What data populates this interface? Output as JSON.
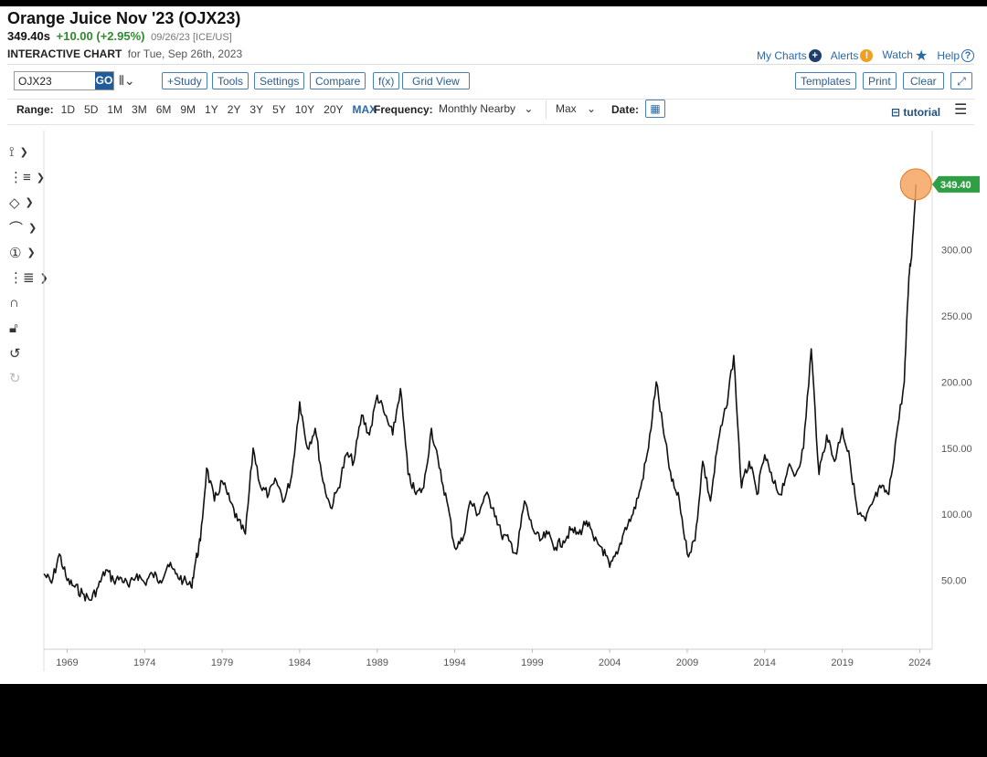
{
  "header": {
    "title": "Orange Juice Nov '23 (OJX23)",
    "price": "349.40s",
    "change": "+10.00 (+2.95%)",
    "meta": "09/26/23 [ICE/US]",
    "subhead_bold": "INTERACTIVE CHART",
    "subhead_text": "for Tue, Sep 26th, 2023"
  },
  "toplinks": {
    "my_charts": "My Charts",
    "alerts": "Alerts",
    "watch": "Watch",
    "help": "Help"
  },
  "toolbar": {
    "symbol_value": "OJX23",
    "go_label": "GO",
    "study_label": "+Study",
    "tools_label": "Tools",
    "settings_label": "Settings",
    "compare_label": "Compare",
    "fx_label": "f(x)",
    "grid_view_label": "Grid View",
    "templates_label": "Templates",
    "print_label": "Print",
    "clear_label": "Clear",
    "expand_icon": "expand-icon"
  },
  "rangebar": {
    "range_label": "Range:",
    "ranges": [
      "1D",
      "5D",
      "1M",
      "3M",
      "6M",
      "9M",
      "1Y",
      "2Y",
      "3Y",
      "5Y",
      "10Y",
      "20Y",
      "MAX"
    ],
    "selected": "MAX",
    "frequency_label": "Frequency:",
    "frequency_value": "Monthly Nearby",
    "max_value": "Max",
    "date_label": "Date:",
    "tutorial_label": "tutorial"
  },
  "drawtools": [
    "crosshair-icon",
    "fib-icon",
    "shapes-icon",
    "arc-icon",
    "numbered-annotation-icon",
    "pattern-icon",
    "magnet-icon",
    "lock-icon",
    "undo-icon",
    "redo-icon"
  ],
  "colors": {
    "accent": "#2a6aaa",
    "up_green": "#2e8b2e",
    "price_badge": "#2ea043",
    "marker_orange": "#f4a460",
    "line": "#111111"
  },
  "chart_data": {
    "type": "line",
    "series": [
      {
        "name": "OJX23",
        "x": [
          1967.5,
          1968.0,
          1968.5,
          1969.0,
          1969.5,
          1970.0,
          1970.5,
          1971.0,
          1971.5,
          1972.0,
          1972.5,
          1973.0,
          1973.5,
          1974.0,
          1974.5,
          1975.0,
          1975.5,
          1976.0,
          1976.5,
          1977.0,
          1977.3,
          1977.6,
          1978.0,
          1978.5,
          1979.0,
          1979.5,
          1980.0,
          1980.5,
          1981.0,
          1981.5,
          1982.0,
          1982.5,
          1983.0,
          1983.5,
          1984.0,
          1984.5,
          1985.0,
          1985.5,
          1986.0,
          1986.5,
          1987.0,
          1987.5,
          1988.0,
          1988.5,
          1989.0,
          1989.5,
          1990.0,
          1990.5,
          1991.0,
          1991.5,
          1992.0,
          1992.5,
          1993.0,
          1993.5,
          1994.0,
          1994.5,
          1995.0,
          1995.5,
          1996.0,
          1996.5,
          1997.0,
          1997.5,
          1998.0,
          1998.5,
          1999.0,
          1999.5,
          2000.0,
          2000.5,
          2001.0,
          2001.5,
          2002.0,
          2002.5,
          2003.0,
          2003.5,
          2004.0,
          2004.5,
          2005.0,
          2005.5,
          2006.0,
          2006.5,
          2007.0,
          2007.5,
          2008.0,
          2008.5,
          2009.0,
          2009.5,
          2010.0,
          2010.5,
          2011.0,
          2011.5,
          2012.0,
          2012.5,
          2013.0,
          2013.5,
          2014.0,
          2014.5,
          2015.0,
          2015.5,
          2016.0,
          2016.5,
          2017.0,
          2017.5,
          2018.0,
          2018.5,
          2019.0,
          2019.5,
          2020.0,
          2020.5,
          2021.0,
          2021.5,
          2022.0,
          2022.5,
          2023.0,
          2023.3,
          2023.5,
          2023.75
        ],
        "y": [
          55,
          48,
          70,
          50,
          45,
          40,
          35,
          45,
          58,
          50,
          52,
          45,
          55,
          48,
          55,
          50,
          62,
          55,
          50,
          45,
          65,
          80,
          135,
          110,
          125,
          110,
          95,
          85,
          150,
          120,
          115,
          125,
          110,
          130,
          185,
          150,
          165,
          125,
          105,
          120,
          145,
          140,
          175,
          160,
          190,
          175,
          160,
          195,
          130,
          115,
          120,
          165,
          135,
          110,
          75,
          80,
          110,
          100,
          115,
          105,
          85,
          80,
          70,
          110,
          90,
          80,
          85,
          75,
          80,
          88,
          85,
          95,
          80,
          75,
          60,
          70,
          90,
          100,
          120,
          150,
          200,
          160,
          125,
          110,
          70,
          80,
          140,
          110,
          155,
          180,
          220,
          120,
          140,
          115,
          145,
          125,
          115,
          135,
          130,
          150,
          225,
          130,
          160,
          140,
          165,
          140,
          100,
          95,
          110,
          120,
          115,
          160,
          200,
          280,
          300,
          349.4
        ]
      }
    ],
    "x_ticks": [
      "1969",
      "1974",
      "1979",
      "1984",
      "1989",
      "1994",
      "1999",
      "2004",
      "2009",
      "2014",
      "2019",
      "2024"
    ],
    "x_tick_values": [
      1969,
      1974,
      1979,
      1984,
      1989,
      1994,
      1999,
      2004,
      2009,
      2014,
      2019,
      2024
    ],
    "y_ticks": [
      "50.00",
      "100.00",
      "150.00",
      "200.00",
      "250.00",
      "300.00"
    ],
    "y_tick_values": [
      50,
      100,
      150,
      200,
      250,
      300
    ],
    "xlim": [
      1967.5,
      2024.8
    ],
    "ylim": [
      -2,
      390
    ],
    "last_value_label": "349.40",
    "last_value": 349.4,
    "grid": false,
    "y_axis_side": "right"
  }
}
